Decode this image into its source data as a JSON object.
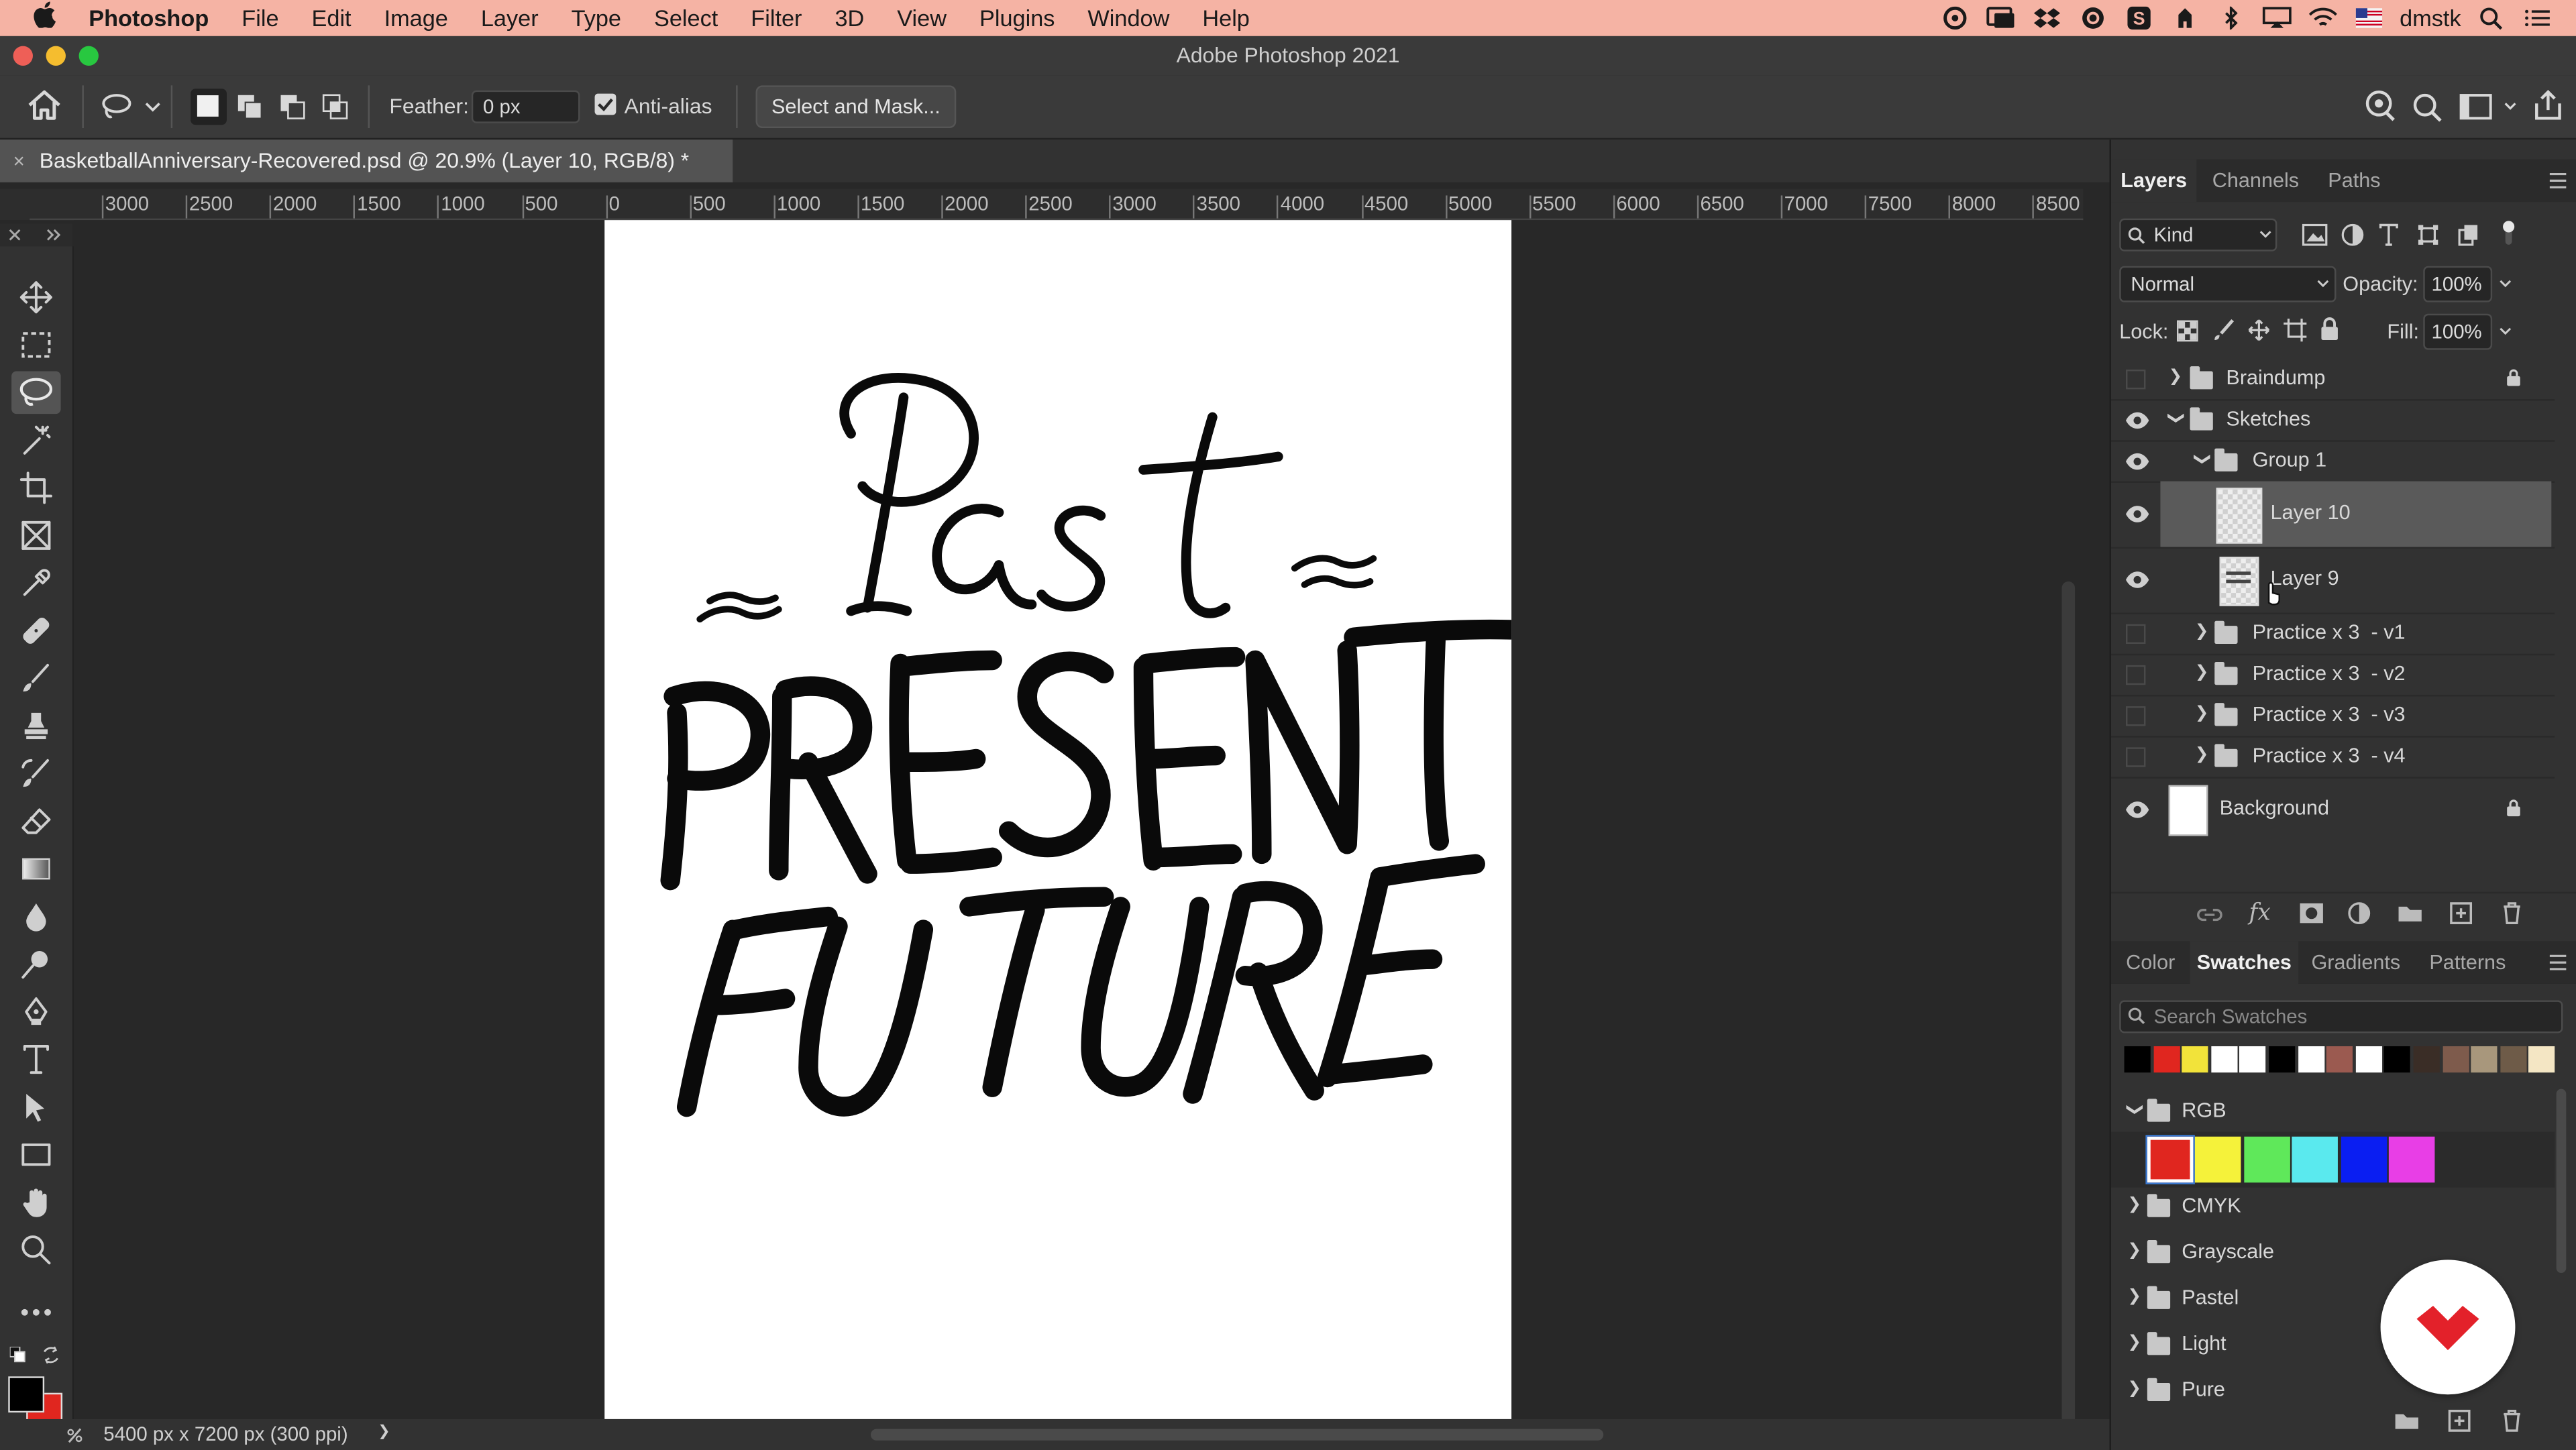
{
  "menubar": {
    "app_name": "Photoshop",
    "items": [
      "File",
      "Edit",
      "Image",
      "Layer",
      "Type",
      "Select",
      "Filter",
      "3D",
      "View",
      "Plugins",
      "Window",
      "Help"
    ],
    "user": "dmstk"
  },
  "window": {
    "title": "Adobe Photoshop 2021"
  },
  "options": {
    "feather_label": "Feather:",
    "feather_value": "0 px",
    "antialias_label": "Anti-alias",
    "antialias_checked": true,
    "select_mask_label": "Select and Mask..."
  },
  "document": {
    "tab_title": "BasketballAnniversary-Recovered.psd @ 20.9% (Layer 10, RGB/8) *",
    "close_glyph": "×",
    "lettering": [
      "Past",
      "PRESENT",
      "FUTURE"
    ]
  },
  "ruler": {
    "labels": [
      "3000",
      "2500",
      "2000",
      "1500",
      "1000",
      "500",
      "0",
      "500",
      "1000",
      "1500",
      "2000",
      "2500",
      "3000",
      "3500",
      "4000",
      "4500",
      "5000",
      "5500",
      "6000",
      "6500",
      "7000",
      "7500",
      "8000",
      "8500"
    ]
  },
  "status": {
    "dimensions": "5400 px x 7200 px (300 ppi)",
    "arrow": "❯"
  },
  "layers_panel": {
    "tabs": [
      "Layers",
      "Channels",
      "Paths"
    ],
    "active_tab": "Layers",
    "filter_kind": "Kind",
    "blend_mode": "Normal",
    "opacity_label": "Opacity:",
    "opacity_value": "100%",
    "lock_label": "Lock:",
    "fill_label": "Fill:",
    "fill_value": "100%",
    "layers": [
      {
        "name": "Braindump",
        "type": "group",
        "visible": false,
        "indent": 0,
        "expanded": false,
        "locked": true
      },
      {
        "name": "Sketches",
        "type": "group",
        "visible": true,
        "indent": 0,
        "expanded": true,
        "locked": false
      },
      {
        "name": "Group 1",
        "type": "group",
        "visible": true,
        "indent": 1,
        "expanded": true,
        "locked": false
      },
      {
        "name": "Layer 10",
        "type": "layer",
        "visible": true,
        "indent": 2,
        "selected": true
      },
      {
        "name": "Layer 9",
        "type": "layer",
        "visible": true,
        "indent": 2,
        "selected": false
      },
      {
        "name": "Practice x 3  - v1",
        "type": "group",
        "visible": false,
        "indent": 1,
        "expanded": false
      },
      {
        "name": "Practice x 3  - v2",
        "type": "group",
        "visible": false,
        "indent": 1,
        "expanded": false
      },
      {
        "name": "Practice x 3  - v3",
        "type": "group",
        "visible": false,
        "indent": 1,
        "expanded": false
      },
      {
        "name": "Practice x 3  - v4",
        "type": "group",
        "visible": false,
        "indent": 1,
        "expanded": false
      },
      {
        "name": "Background",
        "type": "background",
        "visible": true,
        "indent": 0,
        "locked": true
      }
    ]
  },
  "swatches_panel": {
    "tabs": [
      "Color",
      "Swatches",
      "Gradients",
      "Patterns"
    ],
    "active_tab": "Swatches",
    "search_placeholder": "Search Swatches",
    "recent_colors": [
      "#000000",
      "#e0261f",
      "#f2e33a",
      "#ffffff",
      "#ffffff",
      "#000000",
      "#ffffff",
      "#9b5a50",
      "#ffffff",
      "#000000",
      "#3a2d26",
      "#7e5b4c",
      "#a8977c",
      "#6e5b48",
      "#f4e6c4"
    ],
    "groups": [
      {
        "name": "RGB",
        "expanded": true,
        "colors": [
          "#e0261f",
          "#f5f23a",
          "#5fe85a",
          "#5ae9ee",
          "#0a1ef2",
          "#e83ee6"
        ]
      },
      {
        "name": "CMYK",
        "expanded": false
      },
      {
        "name": "Grayscale",
        "expanded": false
      },
      {
        "name": "Pastel",
        "expanded": false
      },
      {
        "name": "Light",
        "expanded": false
      },
      {
        "name": "Pure",
        "expanded": false
      }
    ]
  },
  "colors": {
    "foreground": "#000000",
    "background": "#e0261f",
    "menubar_bg": "#f5b3a4",
    "badge_red": "#e3212a"
  }
}
